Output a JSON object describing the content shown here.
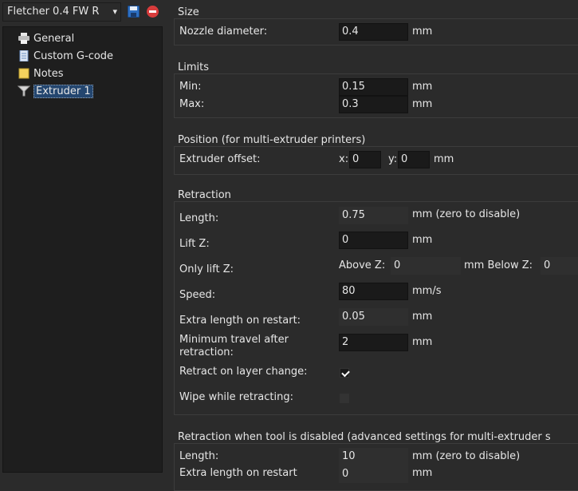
{
  "toolbar": {
    "preset_name": "Fletcher 0.4 FW R",
    "dropdown_arrow": "▾",
    "save_icon": "save-icon",
    "delete_icon": "delete-icon"
  },
  "tree": {
    "items": [
      {
        "label": "General",
        "icon": "printer-icon"
      },
      {
        "label": "Custom G-code",
        "icon": "document-icon"
      },
      {
        "label": "Notes",
        "icon": "note-icon"
      },
      {
        "label": "Extruder 1",
        "icon": "funnel-icon",
        "selected": true
      }
    ]
  },
  "size": {
    "title": "Size",
    "nozzle_label": "Nozzle diameter:",
    "nozzle_value": "0.4",
    "nozzle_unit": "mm"
  },
  "limits": {
    "title": "Limits",
    "min_label": "Min:",
    "min_value": "0.15",
    "min_unit": "mm",
    "max_label": "Max:",
    "max_value": "0.3",
    "max_unit": "mm"
  },
  "position": {
    "title": "Position (for multi-extruder printers)",
    "offset_label": "Extruder offset:",
    "x_label": "x:",
    "x_value": "0",
    "y_label": "y:",
    "y_value": "0",
    "unit": "mm"
  },
  "retraction": {
    "title": "Retraction",
    "length_label": "Length:",
    "length_value": "0.75",
    "length_unit": "mm (zero to disable)",
    "lift_label": "Lift Z:",
    "lift_value": "0",
    "lift_unit": "mm",
    "only_lift_label": "Only lift Z:",
    "above_label": "Above Z:",
    "above_value": "0",
    "below_label": "mm Below Z:",
    "below_value": "0",
    "speed_label": "Speed:",
    "speed_value": "80",
    "speed_unit": "mm/s",
    "extra_label": "Extra length on restart:",
    "extra_value": "0.05",
    "extra_unit": "mm",
    "min_travel_label_1": "Minimum travel after",
    "min_travel_label_2": "retraction:",
    "min_travel_value": "2",
    "min_travel_unit": "mm",
    "layer_change_label": "Retract on layer change:",
    "layer_change_checked": true,
    "wipe_label": "Wipe while retracting:",
    "wipe_checked": false
  },
  "retraction_disabled": {
    "title": "Retraction when tool is disabled (advanced settings for multi-extruder s",
    "length_label": "Length:",
    "length_value": "10",
    "length_unit": "mm (zero to disable)",
    "extra_label": "Extra length on restart",
    "extra_value": "0",
    "extra_unit": "mm"
  }
}
